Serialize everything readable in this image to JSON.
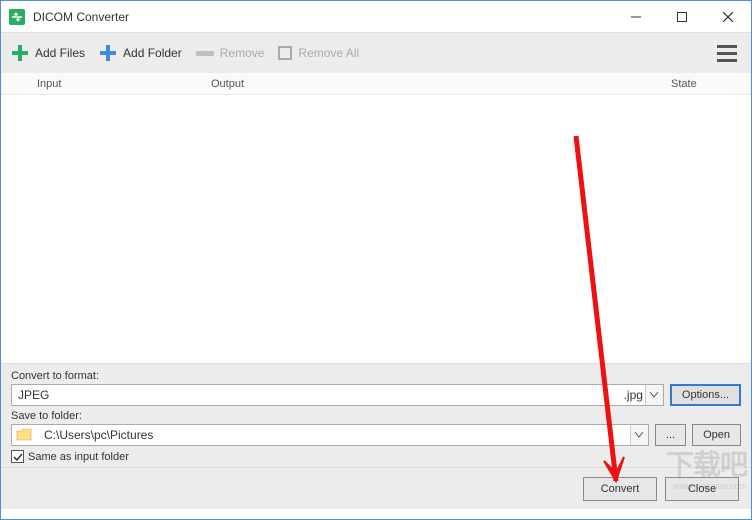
{
  "title": "DICOM Converter",
  "toolbar": {
    "add_files": "Add Files",
    "add_folder": "Add Folder",
    "remove": "Remove",
    "remove_all": "Remove All"
  },
  "columns": {
    "input": "Input",
    "output": "Output",
    "state": "State"
  },
  "convert_panel": {
    "format_label": "Convert to format:",
    "format_value": "JPEG",
    "format_ext": ".jpg",
    "options_btn": "Options...",
    "folder_label": "Save to folder:",
    "folder_value": "C:\\Users\\pc\\Pictures",
    "browse_btn": "...",
    "open_btn": "Open",
    "same_folder_label": "Same as input folder",
    "same_folder_checked": true
  },
  "footer": {
    "convert": "Convert",
    "close": "Close"
  },
  "watermark": {
    "main": "下载吧",
    "sub": "www.xiazaiba.com"
  }
}
